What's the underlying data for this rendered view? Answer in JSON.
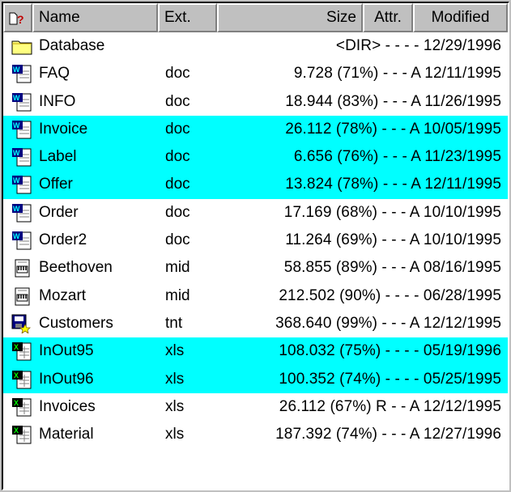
{
  "columns": {
    "name": "Name",
    "ext": "Ext.",
    "size": "Size",
    "attr": "Attr.",
    "modified": "Modified"
  },
  "files": [
    {
      "name": "Database",
      "ext": "",
      "info": "<DIR> - - - - 12/29/1996",
      "icon": "folder-icon",
      "selected": false
    },
    {
      "name": "FAQ",
      "ext": "doc",
      "info": "9.728 (71%) - - - A 12/11/1995",
      "icon": "word-document-icon",
      "selected": false
    },
    {
      "name": "INFO",
      "ext": "doc",
      "info": "18.944 (83%) - - - A 11/26/1995",
      "icon": "word-document-icon",
      "selected": false
    },
    {
      "name": "Invoice",
      "ext": "doc",
      "info": "26.112 (78%) - - - A 10/05/1995",
      "icon": "word-document-icon",
      "selected": true
    },
    {
      "name": "Label",
      "ext": "doc",
      "info": "6.656 (76%) - - - A 11/23/1995",
      "icon": "word-document-icon",
      "selected": true
    },
    {
      "name": "Offer",
      "ext": "doc",
      "info": "13.824 (78%) - - - A 12/11/1995",
      "icon": "word-document-icon",
      "selected": true
    },
    {
      "name": "Order",
      "ext": "doc",
      "info": "17.169 (68%) - - - A 10/10/1995",
      "icon": "word-document-icon",
      "selected": false
    },
    {
      "name": "Order2",
      "ext": "doc",
      "info": "11.264 (69%) - - - A 10/10/1995",
      "icon": "word-document-icon",
      "selected": false
    },
    {
      "name": "Beethoven",
      "ext": "mid",
      "info": "58.855 (89%) - - - A 08/16/1995",
      "icon": "midi-file-icon",
      "selected": false
    },
    {
      "name": "Mozart",
      "ext": "mid",
      "info": "212.502 (90%) - - - - 06/28/1995",
      "icon": "midi-file-icon",
      "selected": false
    },
    {
      "name": "Customers",
      "ext": "tnt",
      "info": "368.640 (99%) - - - A 12/12/1995",
      "icon": "database-file-icon",
      "selected": false
    },
    {
      "name": "InOut95",
      "ext": "xls",
      "info": "108.032 (75%) - - - - 05/19/1996",
      "icon": "excel-sheet-icon",
      "selected": true
    },
    {
      "name": "InOut96",
      "ext": "xls",
      "info": "100.352 (74%) - - - - 05/25/1995",
      "icon": "excel-sheet-icon",
      "selected": true
    },
    {
      "name": "Invoices",
      "ext": "xls",
      "info": "26.112 (67%) R - - A 12/12/1995",
      "icon": "excel-sheet-icon",
      "selected": false
    },
    {
      "name": "Material",
      "ext": "xls",
      "info": "187.392 (74%) - - - A 12/27/1996",
      "icon": "excel-sheet-icon",
      "selected": false
    }
  ],
  "colors": {
    "selection": "#00ffff",
    "header": "#c0c0c0"
  }
}
